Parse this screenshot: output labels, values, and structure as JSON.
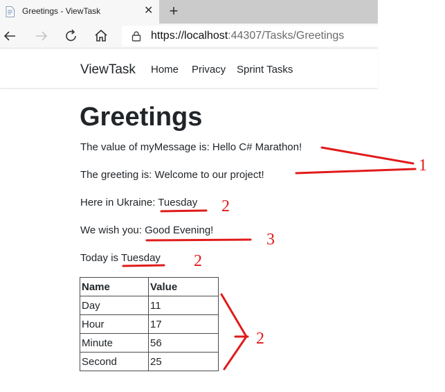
{
  "browser": {
    "tab_title": "Greetings - ViewTask",
    "tab_close_glyph": "✕",
    "new_tab_glyph": "+",
    "url_host": "https://localhost",
    "url_rest": ":44307/Tasks/Greetings",
    "icons": [
      "page-icon",
      "close-icon",
      "plus-icon",
      "back-arrow-icon",
      "forward-arrow-icon",
      "refresh-icon",
      "home-icon",
      "lock-icon"
    ]
  },
  "navbar": {
    "brand": "ViewTask",
    "links": [
      "Home",
      "Privacy",
      "Sprint Tasks"
    ]
  },
  "main": {
    "title": "Greetings",
    "lines": {
      "message_prefix": "The value of myMessage is: ",
      "message_value": "Hello C# Marathon!",
      "greeting": "The greeting is: Welcome to our project!",
      "ukraine_prefix": "Here in Ukraine: ",
      "ukraine_day": "Tuesday",
      "wish_prefix": "We wish you: ",
      "wish_value": "Good Evening!",
      "today_prefix": "Today is ",
      "today_day": "Tuesday"
    },
    "table": {
      "headers": [
        "Name",
        "Value"
      ],
      "rows": [
        [
          "Day",
          "11"
        ],
        [
          "Hour",
          "17"
        ],
        [
          "Minute",
          "56"
        ],
        [
          "Second",
          "25"
        ]
      ]
    }
  },
  "annotations": {
    "color": "#e11a1a",
    "labels": [
      "1",
      "2",
      "3",
      "2",
      "2"
    ]
  }
}
